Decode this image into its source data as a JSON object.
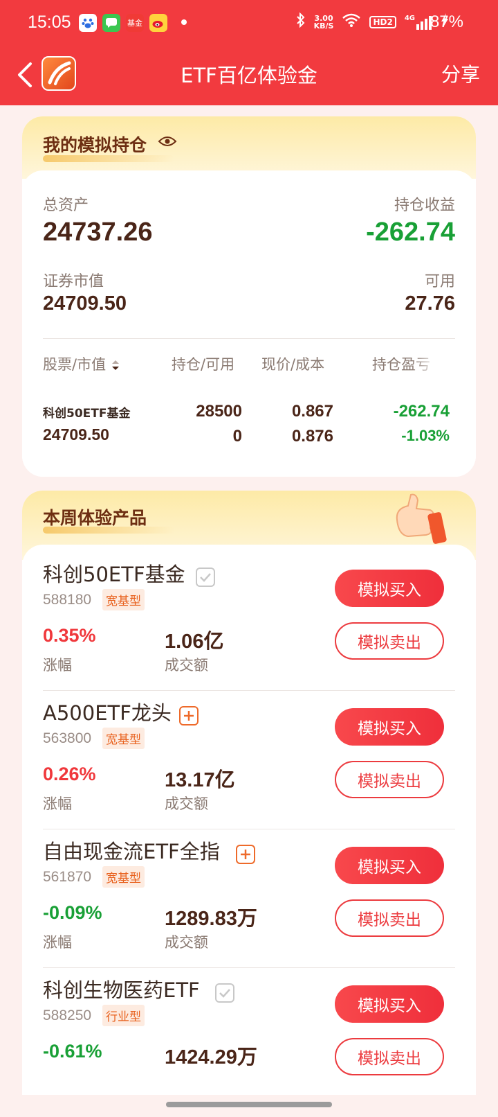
{
  "status_bar": {
    "time": "15:05",
    "speed_top": "3.00",
    "speed_bottom": "KB/S",
    "hd": "HD2",
    "network": "4G",
    "battery": "87%",
    "fund_icon_text": "基金"
  },
  "nav": {
    "title": "ETF百亿体验金",
    "share": "分享"
  },
  "holdings": {
    "title": "我的模拟持仓",
    "total_assets_label": "总资产",
    "total_assets": "24737.26",
    "profit_label": "持仓收益",
    "profit": "-262.74",
    "market_value_label": "证券市值",
    "market_value": "24709.50",
    "available_label": "可用",
    "available": "27.76",
    "columns": [
      "股票/市值",
      "持仓/可用",
      "现价/成本",
      "持仓盈亏"
    ],
    "row": {
      "name": "科创50ETF基金",
      "value": "24709.50",
      "position": "28500",
      "usable": "0",
      "price": "0.867",
      "cost": "0.876",
      "pl": "-262.74",
      "pl_pct": "-1.03%"
    }
  },
  "weekly": {
    "title": "本周体验产品",
    "change_label": "涨幅",
    "turnover_label": "成交额",
    "buy_label": "模拟买入",
    "sell_label": "模拟卖出",
    "products": [
      {
        "name": "科创50ETF基金",
        "code": "588180",
        "tag": "宽基型",
        "change": "0.35%",
        "turnover": "1.06亿",
        "selected": true
      },
      {
        "name": "A500ETF龙头",
        "code": "563800",
        "tag": "宽基型",
        "change": "0.26%",
        "turnover": "13.17亿",
        "selected": false
      },
      {
        "name": "自由现金流ETF全指",
        "code": "561870",
        "tag": "宽基型",
        "change": "-0.09%",
        "turnover": "1289.83万",
        "selected": false
      },
      {
        "name": "科创生物医药ETF",
        "code": "588250",
        "tag": "行业型",
        "change": "-0.61%",
        "turnover": "1424.29万",
        "selected": true
      }
    ]
  },
  "colors": {
    "brand_red": "#f23a3f",
    "up_red": "#f0383c",
    "down_green": "#19a036"
  }
}
